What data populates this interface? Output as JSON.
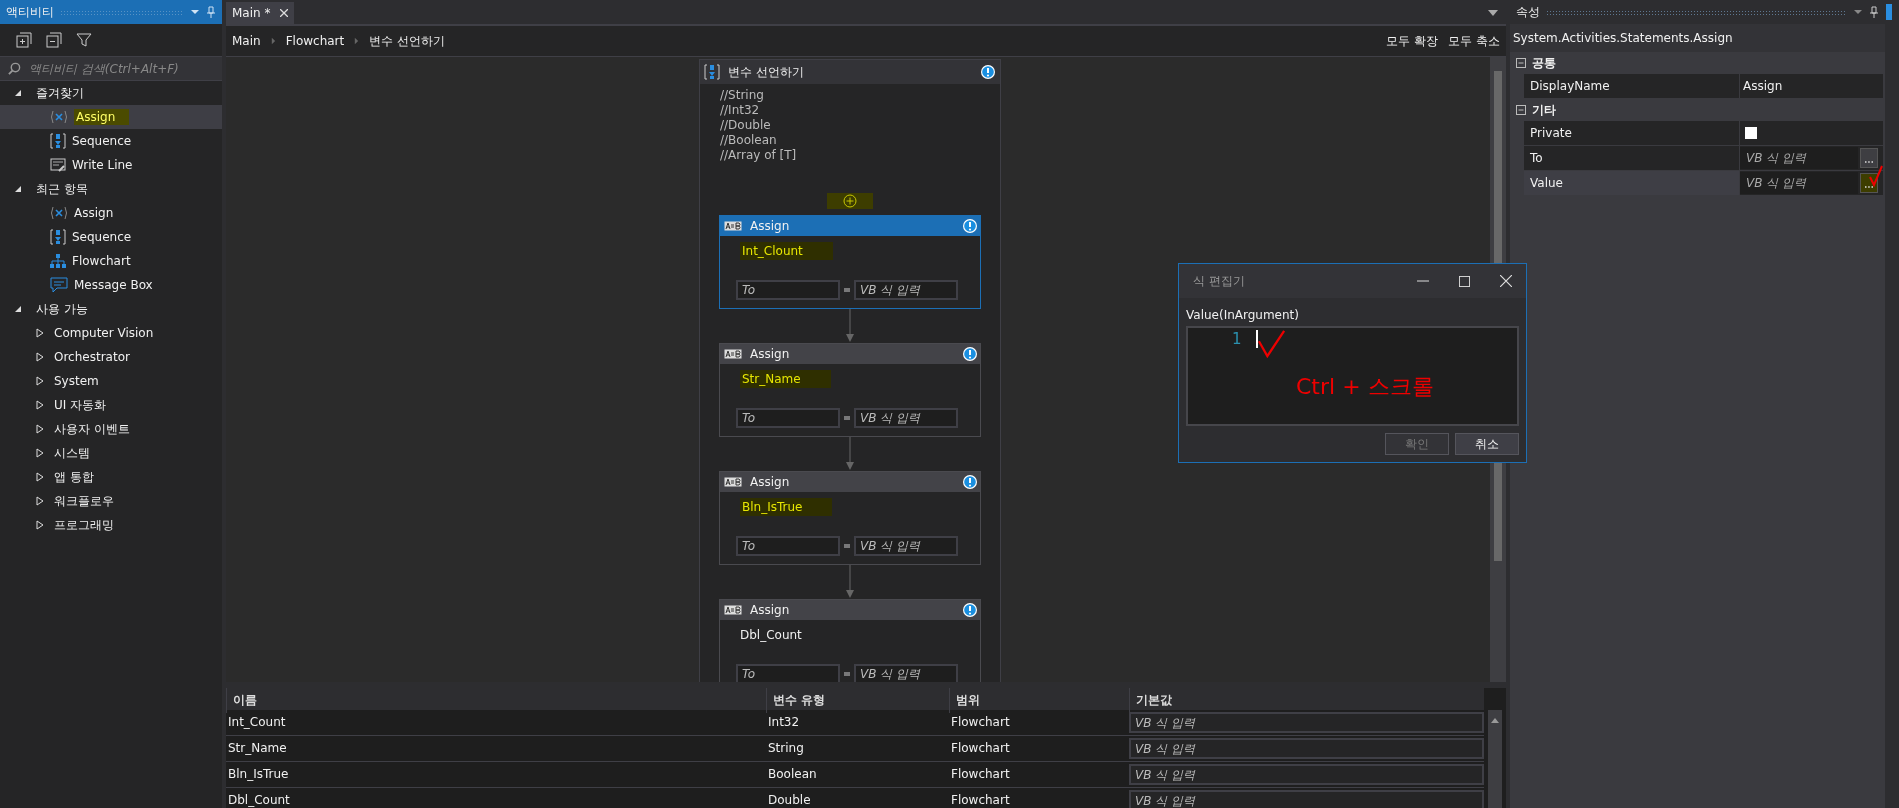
{
  "activities_panel": {
    "title": "액티비티",
    "search": {
      "placeholder": "액티비티 검색(Ctrl+Alt+F)"
    },
    "groups": [
      {
        "label": "즐겨찾기",
        "expanded": true,
        "children": [
          {
            "label": "Assign",
            "kind": "assign",
            "selected": true,
            "highlighted": true
          },
          {
            "label": "Sequence",
            "kind": "sequence",
            "selected": false,
            "highlighted": false
          },
          {
            "label": "Write Line",
            "kind": "writeline",
            "selected": false,
            "highlighted": false
          }
        ]
      },
      {
        "label": "최근 항목",
        "expanded": true,
        "children": [
          {
            "label": "Assign",
            "kind": "assign",
            "selected": false,
            "highlighted": false
          },
          {
            "label": "Sequence",
            "kind": "sequence",
            "selected": false,
            "highlighted": false
          },
          {
            "label": "Flowchart",
            "kind": "flowchart",
            "selected": false,
            "highlighted": false
          },
          {
            "label": "Message Box",
            "kind": "messagebox",
            "selected": false,
            "highlighted": false
          }
        ]
      },
      {
        "label": "사용 가능",
        "expanded": true,
        "children": [
          {
            "label": "Computer Vision",
            "kind": "category",
            "selected": false,
            "highlighted": false
          },
          {
            "label": "Orchestrator",
            "kind": "category",
            "selected": false,
            "highlighted": false
          },
          {
            "label": "System",
            "kind": "category",
            "selected": false,
            "highlighted": false
          },
          {
            "label": "UI 자동화",
            "kind": "category",
            "selected": false,
            "highlighted": false
          },
          {
            "label": "사용자 이벤트",
            "kind": "category",
            "selected": false,
            "highlighted": false
          },
          {
            "label": "시스템",
            "kind": "category",
            "selected": false,
            "highlighted": false
          },
          {
            "label": "앱 통합",
            "kind": "category",
            "selected": false,
            "highlighted": false
          },
          {
            "label": "워크플로우",
            "kind": "category",
            "selected": false,
            "highlighted": false
          },
          {
            "label": "프로그래밍",
            "kind": "category",
            "selected": false,
            "highlighted": false
          }
        ]
      }
    ]
  },
  "editor": {
    "tabs": [
      {
        "label": "Main *",
        "selected": true
      }
    ],
    "breadcrumb": [
      "Main",
      "Flowchart",
      "변수 선언하기"
    ],
    "actions": [
      "모두 확장",
      "모두 축소"
    ],
    "sequence": {
      "title": "변수 선언하기",
      "comments": [
        "//String",
        "//Int32",
        "//Double",
        "//Boolean",
        "//Array of [T]"
      ],
      "add_highlighted": true,
      "activities": [
        {
          "title": "Assign",
          "name": "Int_Clount",
          "selected": true,
          "highlighted": true,
          "to_placeholder": "To",
          "value_placeholder": "VB 식 입력"
        },
        {
          "title": "Assign",
          "name": "Str_Name",
          "selected": false,
          "highlighted": true,
          "to_placeholder": "To",
          "value_placeholder": "VB 식 입력"
        },
        {
          "title": "Assign",
          "name": "Bln_IsTrue",
          "selected": false,
          "highlighted": true,
          "to_placeholder": "To",
          "value_placeholder": "VB 식 입력"
        },
        {
          "title": "Assign",
          "name": "Dbl_Count",
          "selected": false,
          "highlighted": false,
          "to_placeholder": "To",
          "value_placeholder": "VB 식 입력"
        }
      ]
    },
    "variables": {
      "columns": [
        "이름",
        "변수 유형",
        "범위",
        "기본값"
      ],
      "rows": [
        {
          "name": "Int_Count",
          "type": "Int32",
          "scope": "Flowchart",
          "default_placeholder": "VB 식 입력"
        },
        {
          "name": "Str_Name",
          "type": "String",
          "scope": "Flowchart",
          "default_placeholder": "VB 식 입력"
        },
        {
          "name": "Bln_IsTrue",
          "type": "Boolean",
          "scope": "Flowchart",
          "default_placeholder": "VB 식 입력"
        },
        {
          "name": "Dbl_Count",
          "type": "Double",
          "scope": "Flowchart",
          "default_placeholder": "VB 식 입력"
        }
      ]
    }
  },
  "properties": {
    "title": "속성",
    "type_name": "System.Activities.Statements.Assign",
    "categories": [
      {
        "label": "공통",
        "expanded": true,
        "rows": [
          {
            "label": "DisplayName",
            "kind": "text",
            "value": "Assign",
            "selected": false
          }
        ]
      },
      {
        "label": "기타",
        "expanded": true,
        "rows": [
          {
            "label": "Private",
            "kind": "checkbox",
            "checked": false,
            "selected": false
          },
          {
            "label": "To",
            "kind": "expression",
            "placeholder": "VB 식 입력",
            "selected": false
          },
          {
            "label": "Value",
            "kind": "expression",
            "placeholder": "VB 식 입력",
            "selected": true,
            "highlighted": true
          }
        ]
      }
    ]
  },
  "dialog": {
    "title": "식 편집기",
    "label": "Value(InArgument)",
    "line_number": "1",
    "annotation": "Ctrl + 스크롤",
    "buttons": [
      {
        "label": "확인",
        "disabled": true
      },
      {
        "label": "취소",
        "disabled": false
      }
    ]
  }
}
